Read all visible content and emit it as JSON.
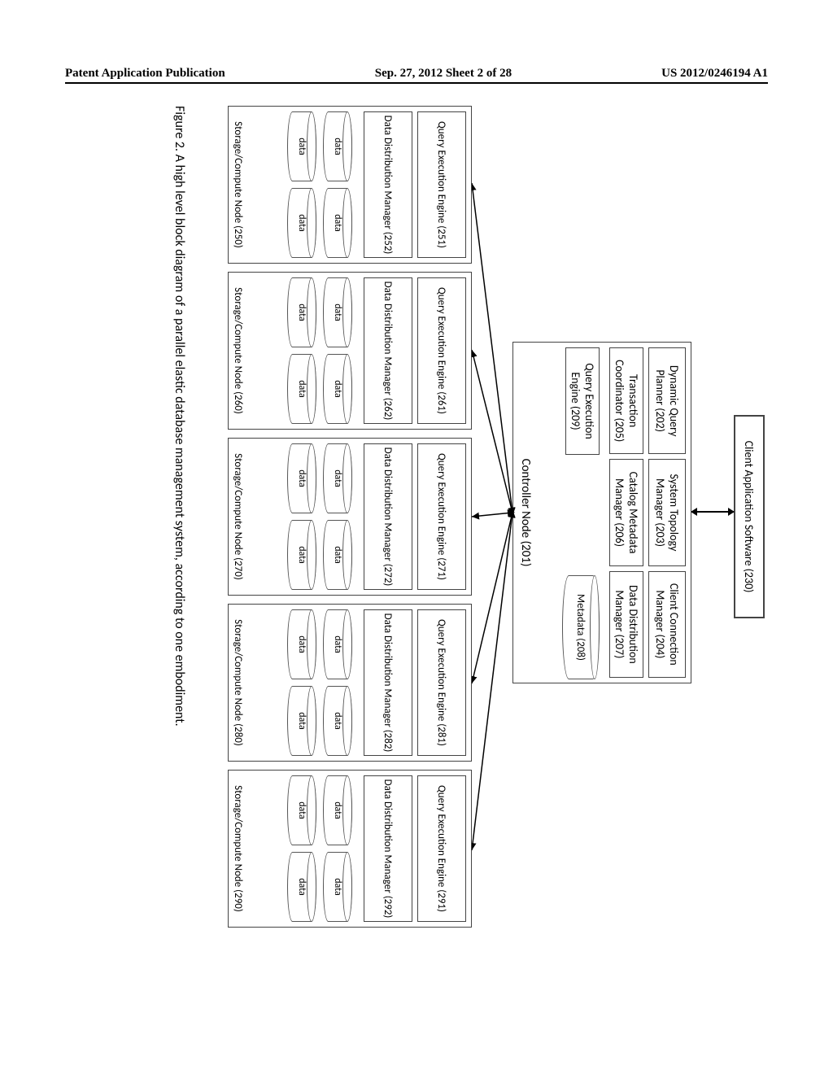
{
  "header": {
    "left": "Patent Application Publication",
    "center": "Sep. 27, 2012  Sheet 2 of 28",
    "right": "US 2012/0246194 A1"
  },
  "client": {
    "label": "Client Application Software (230)"
  },
  "controller": {
    "label": "Controller Node (201)",
    "row1": [
      "Dynamic Query Planner (202)",
      "System Topology Manager (203)",
      "Client Connection Manager (204)"
    ],
    "row2": [
      "Transaction Coordinator (205)",
      "Catalog Metadata Manager (206)",
      "Data Distribution Manager (207)"
    ],
    "row3": [
      "Query Execution Engine (209)"
    ],
    "metadata": "Metadata (208)"
  },
  "storage_nodes": [
    {
      "qee": "Query Execution Engine (251)",
      "ddm": "Data Distribution Manager (252)",
      "label": "Storage/Compute Node (250)"
    },
    {
      "qee": "Query Execution Engine (261)",
      "ddm": "Data Distribution Manager (262)",
      "label": "Storage/Compute Node (260)"
    },
    {
      "qee": "Query Execution Engine (271)",
      "ddm": "Data Distribution Manager (272)",
      "label": "Storage/Compute Node (270)"
    },
    {
      "qee": "Query Execution Engine (281)",
      "ddm": "Data Distribution Manager (282)",
      "label": "Storage/Compute Node (280)"
    },
    {
      "qee": "Query Execution Engine (291)",
      "ddm": "Data Distribution Manager (292)",
      "label": "Storage/Compute Node (290)"
    }
  ],
  "data_label": "data",
  "caption": "Figure 2. A high level block diagram of a parallel elastic database management system, according to one embodiment."
}
